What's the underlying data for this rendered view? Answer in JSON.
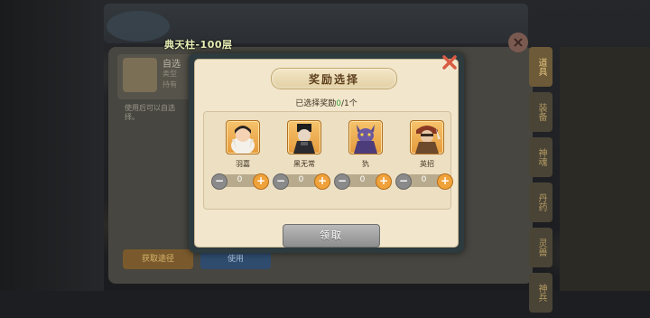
{
  "background": {
    "tower_title": "典天柱-100层",
    "close_glyph": "×",
    "item_name": "自选",
    "item_line1": "类型",
    "item_line2": "持有",
    "desc1": "使用后可以自选",
    "desc2": "择。",
    "btn_left": "获取途径",
    "btn_right": "使用",
    "tabs": [
      "道具",
      "装备",
      "神魂",
      "丹药",
      "灵兽",
      "神兵"
    ]
  },
  "dialog": {
    "title": "奖励选择",
    "selected_prefix": "已选择奖励",
    "selected_count": "0",
    "selected_total": "/1个",
    "close_icon": "x-icon",
    "claim_label": "领取",
    "items": [
      {
        "name": "羽嘉",
        "quantity": "0",
        "icon": "hero-yujia-icon"
      },
      {
        "name": "黑无常",
        "quantity": "0",
        "icon": "hero-heiwuchang-icon"
      },
      {
        "name": "犰",
        "quantity": "0",
        "icon": "hero-qiu-icon"
      },
      {
        "name": "英招",
        "quantity": "0",
        "icon": "hero-yingzhao-icon"
      }
    ],
    "minus_glyph": "−",
    "plus_glyph": "+"
  },
  "colors": {
    "accent_orange": "#f0a23a",
    "selected_green": "#35a03a",
    "close_red": "#d85b43"
  }
}
